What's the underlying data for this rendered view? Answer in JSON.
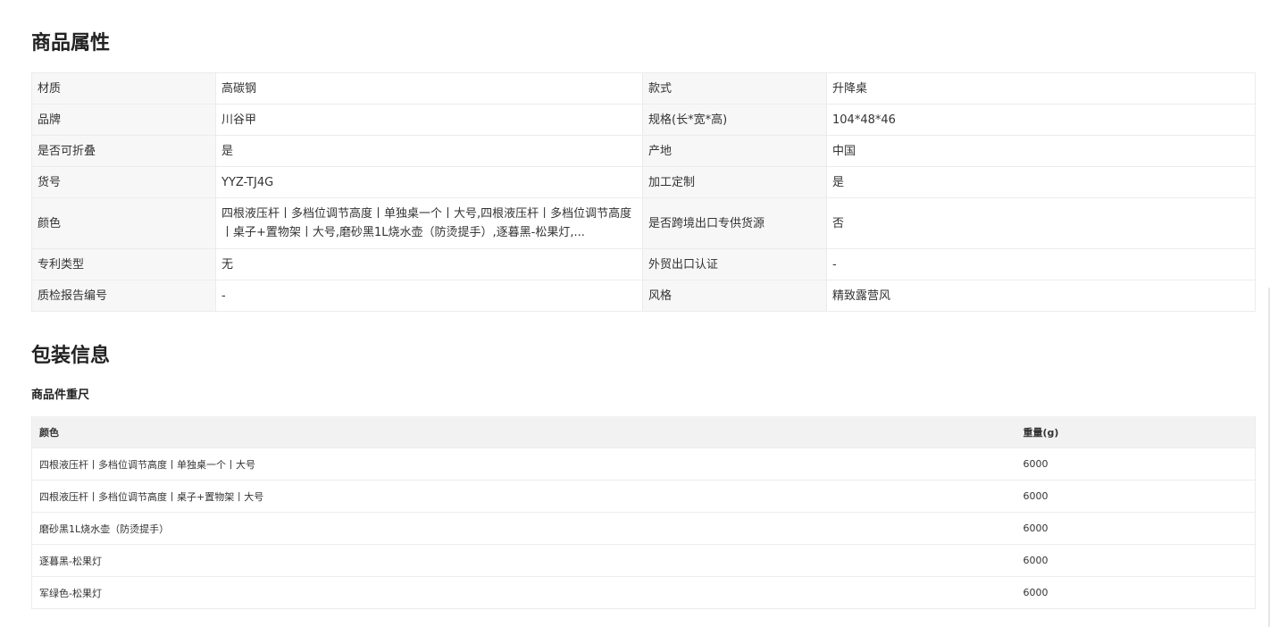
{
  "product_attributes": {
    "title": "商品属性",
    "rows": [
      {
        "k1": "材质",
        "v1": "高碳钢",
        "k2": "款式",
        "v2": "升降桌"
      },
      {
        "k1": "品牌",
        "v1": "川谷甲",
        "k2": "规格(长*宽*高)",
        "v2": "104*48*46"
      },
      {
        "k1": "是否可折叠",
        "v1": "是",
        "k2": "产地",
        "v2": "中国"
      },
      {
        "k1": "货号",
        "v1": "YYZ-TJ4G",
        "k2": "加工定制",
        "v2": "是"
      },
      {
        "k1": "颜色",
        "v1": "四根液压杆丨多档位调节高度丨单独桌一个丨大号,四根液压杆丨多档位调节高度丨桌子+置物架丨大号,磨砂黑1L烧水壶（防烫提手）,逐暮黑-松果灯,...",
        "k2": "是否跨境出口专供货源",
        "v2": "否"
      },
      {
        "k1": "专利类型",
        "v1": "无",
        "k2": "外贸出口认证",
        "v2": "-"
      },
      {
        "k1": "质检报告编号",
        "v1": "-",
        "k2": "风格",
        "v2": "精致露营风"
      }
    ]
  },
  "packaging": {
    "title": "包装信息",
    "subtitle": "商品件重尺",
    "headers": {
      "color": "颜色",
      "weight": "重量(g)"
    },
    "rows": [
      {
        "color": "四根液压杆丨多档位调节高度丨单独桌一个丨大号",
        "weight": "6000"
      },
      {
        "color": "四根液压杆丨多档位调节高度丨桌子+置物架丨大号",
        "weight": "6000"
      },
      {
        "color": "磨砂黑1L烧水壶（防烫提手）",
        "weight": "6000"
      },
      {
        "color": "逐暮黑-松果灯",
        "weight": "6000"
      },
      {
        "color": "军绿色-松果灯",
        "weight": "6000"
      }
    ]
  }
}
